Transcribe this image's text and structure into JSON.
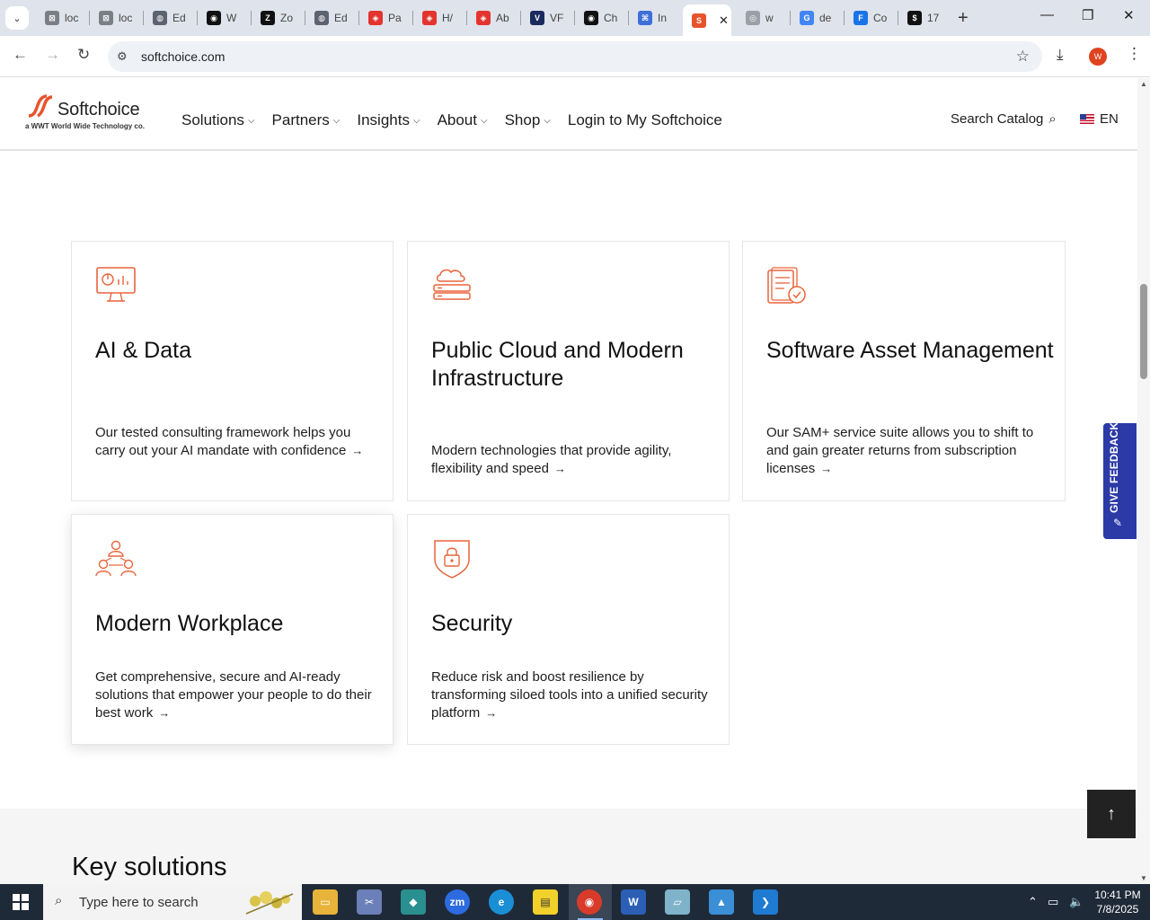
{
  "browser": {
    "tabs": [
      {
        "title": "loc",
        "color": "#7a7f87",
        "glyph": "⊠"
      },
      {
        "title": "loc",
        "color": "#7a7f87",
        "glyph": "⊠"
      },
      {
        "title": "Ed",
        "color": "#5b6270",
        "glyph": "◍"
      },
      {
        "title": "W",
        "color": "#111111",
        "glyph": "◉"
      },
      {
        "title": "Zo",
        "color": "#111111",
        "glyph": "Z"
      },
      {
        "title": "Ed",
        "color": "#5b6270",
        "glyph": "◍"
      },
      {
        "title": "Pa",
        "color": "#e3342f",
        "glyph": "◈"
      },
      {
        "title": "H/",
        "color": "#e3342f",
        "glyph": "◈"
      },
      {
        "title": "Ab",
        "color": "#e3342f",
        "glyph": "◈"
      },
      {
        "title": "VF",
        "color": "#1b2a5c",
        "glyph": "V"
      },
      {
        "title": "Ch",
        "color": "#111111",
        "glyph": "◉"
      },
      {
        "title": "In",
        "color": "#3d6fd8",
        "glyph": "⌘"
      },
      {
        "title": "",
        "color": "#e8532b",
        "glyph": "S",
        "active": true
      },
      {
        "title": "w",
        "color": "#9aa0a8",
        "glyph": "◎"
      },
      {
        "title": "de",
        "color": "#4285f4",
        "glyph": "G"
      },
      {
        "title": "Co",
        "color": "#1a73e8",
        "glyph": "F"
      },
      {
        "title": "17",
        "color": "#111111",
        "glyph": "$"
      }
    ],
    "new_tab": "+",
    "url": "softchoice.com",
    "profile_initial": "W"
  },
  "site": {
    "logo_word": "Softchoice",
    "logo_sub": "a WWT World Wide Technology co.",
    "nav": [
      "Solutions",
      "Partners",
      "Insights",
      "About",
      "Shop"
    ],
    "login": "Login to My Softchoice",
    "search_catalog": "Search Catalog",
    "lang": "EN",
    "accent_color": "#e8643b"
  },
  "cards": [
    {
      "title": "AI & Data",
      "desc": "Our tested consulting framework helps you carry out your AI mandate with confidence",
      "icon": "monitor-chart-icon"
    },
    {
      "title": "Public Cloud and Modern Infrastructure",
      "desc": "Modern technologies that provide agility, flexibility and speed",
      "icon": "cloud-server-icon"
    },
    {
      "title": "Software Asset Management",
      "desc": "Our SAM+ service suite allows you to shift to and gain greater returns from subscription licenses",
      "icon": "clipboard-check-icon"
    },
    {
      "title": "Modern Workplace",
      "desc": "Get comprehensive, secure and AI-ready solutions that empower your people to do their best work",
      "icon": "people-network-icon"
    },
    {
      "title": "Security",
      "desc": "Reduce risk and boost resilience by transforming siloed tools into a unified security platform",
      "icon": "shield-lock-icon"
    }
  ],
  "key_solutions_title": "Key solutions",
  "feedback_label": "GIVE FEEDBACK",
  "taskbar": {
    "search_placeholder": "Type here to search",
    "time": "10:41 PM",
    "date": "7/8/2025"
  }
}
